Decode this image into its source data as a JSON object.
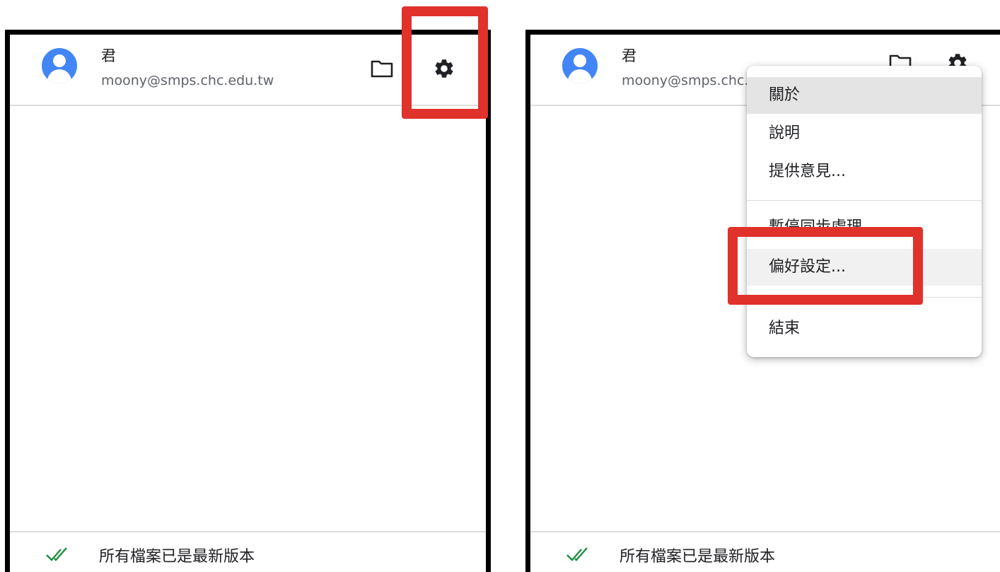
{
  "account": {
    "name": "君",
    "email": "moony@smps.chc.edu.tw"
  },
  "header_icons": {
    "folder": "folder-icon",
    "settings": "gear-icon",
    "avatar": "account-circle-icon"
  },
  "status": {
    "icon": "double-check-icon",
    "text": "所有檔案已是最新版本"
  },
  "menu": {
    "items": [
      {
        "label": "關於"
      },
      {
        "label": "說明"
      },
      {
        "label": "提供意見..."
      },
      {
        "label": "暫停同步處理"
      },
      {
        "label": "偏好設定..."
      },
      {
        "label": "結束"
      }
    ]
  },
  "colors": {
    "avatar": "#4285f4",
    "check": "#1e8e3e",
    "annotation": "#e0312b",
    "panel_border": "#000000"
  }
}
